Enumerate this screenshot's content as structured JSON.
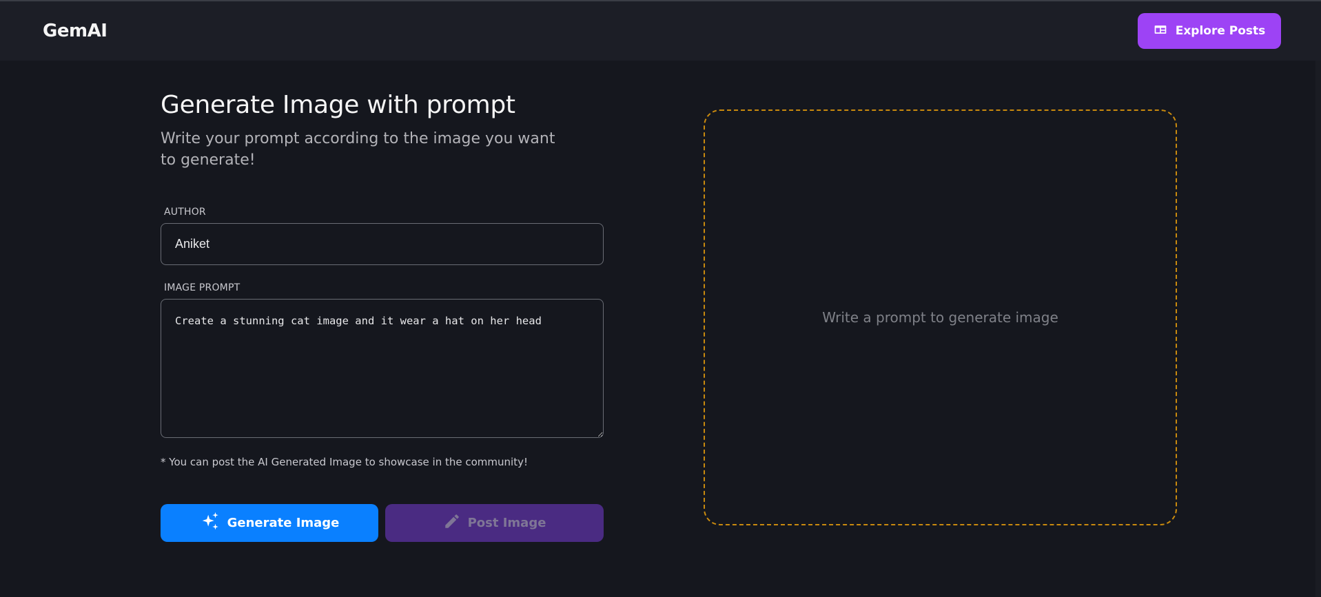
{
  "header": {
    "logo": "GemAI",
    "explore_label": "Explore Posts"
  },
  "form": {
    "title": "Generate Image with prompt",
    "subtitle": "Write your prompt according to the image you want to generate!",
    "author_label": "AUTHOR",
    "author_value": "Aniket",
    "prompt_label": "IMAGE PROMPT",
    "prompt_value": "Create a stunning cat image and it wear a hat on her head",
    "note": "* You can post the AI Generated Image to showcase in the community!",
    "generate_label": "Generate Image",
    "post_label": "Post Image"
  },
  "preview": {
    "placeholder": "Write a prompt to generate image"
  },
  "colors": {
    "accent_purple": "#9d43f5",
    "generate_blue": "#0a80ff",
    "post_disabled": "#4a2b82",
    "dashed_border": "#c98a0e"
  }
}
